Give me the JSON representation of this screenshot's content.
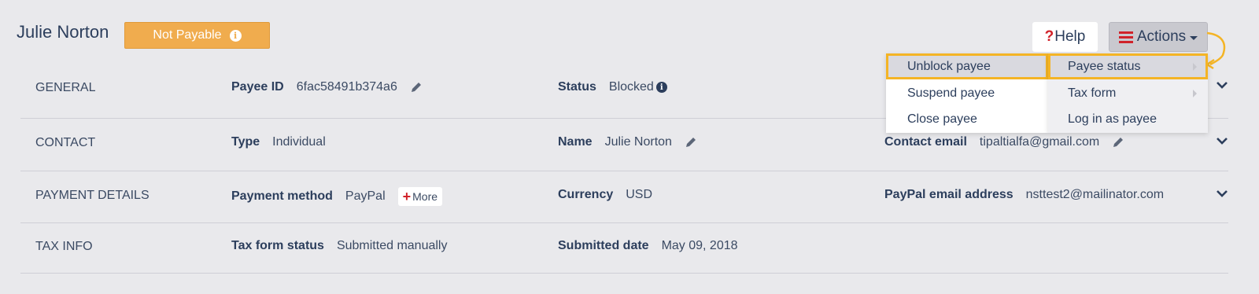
{
  "header": {
    "payee_name": "Julie Norton",
    "status_badge": "Not Payable",
    "help_label": "Help",
    "actions_label": "Actions"
  },
  "rows": [
    {
      "label": "GENERAL",
      "fields": [
        {
          "key": "Payee ID",
          "value": "6fac58491b374a6"
        },
        {
          "key": "Status",
          "value": "Blocked"
        }
      ]
    },
    {
      "label": "CONTACT",
      "fields": [
        {
          "key": "Type",
          "value": "Individual"
        },
        {
          "key": "Name",
          "value": "Julie Norton"
        },
        {
          "key": "Contact email",
          "value": "tipaltialfa@gmail.com"
        }
      ]
    },
    {
      "label": "PAYMENT DETAILS",
      "fields": [
        {
          "key": "Payment method",
          "value": "PayPal"
        },
        {
          "key": "Currency",
          "value": "USD"
        },
        {
          "key": "PayPal email address",
          "value": "nsttest2@mailinator.com"
        }
      ],
      "more_label": "More"
    },
    {
      "label": "TAX INFO",
      "fields": [
        {
          "key": "Tax form status",
          "value": "Submitted manually"
        },
        {
          "key": "Submitted date",
          "value": "May 09, 2018"
        }
      ]
    }
  ],
  "actions_menu": {
    "left_items": [
      "Unblock payee",
      "Suspend payee",
      "Close payee"
    ],
    "right_items": [
      "Payee status",
      "Tax form",
      "Log in as payee"
    ]
  },
  "colors": {
    "badge": "#f0ac4e",
    "highlight_outline": "#f4b425",
    "accent_red": "#d0222a",
    "text_dark": "#2c3e5c"
  }
}
